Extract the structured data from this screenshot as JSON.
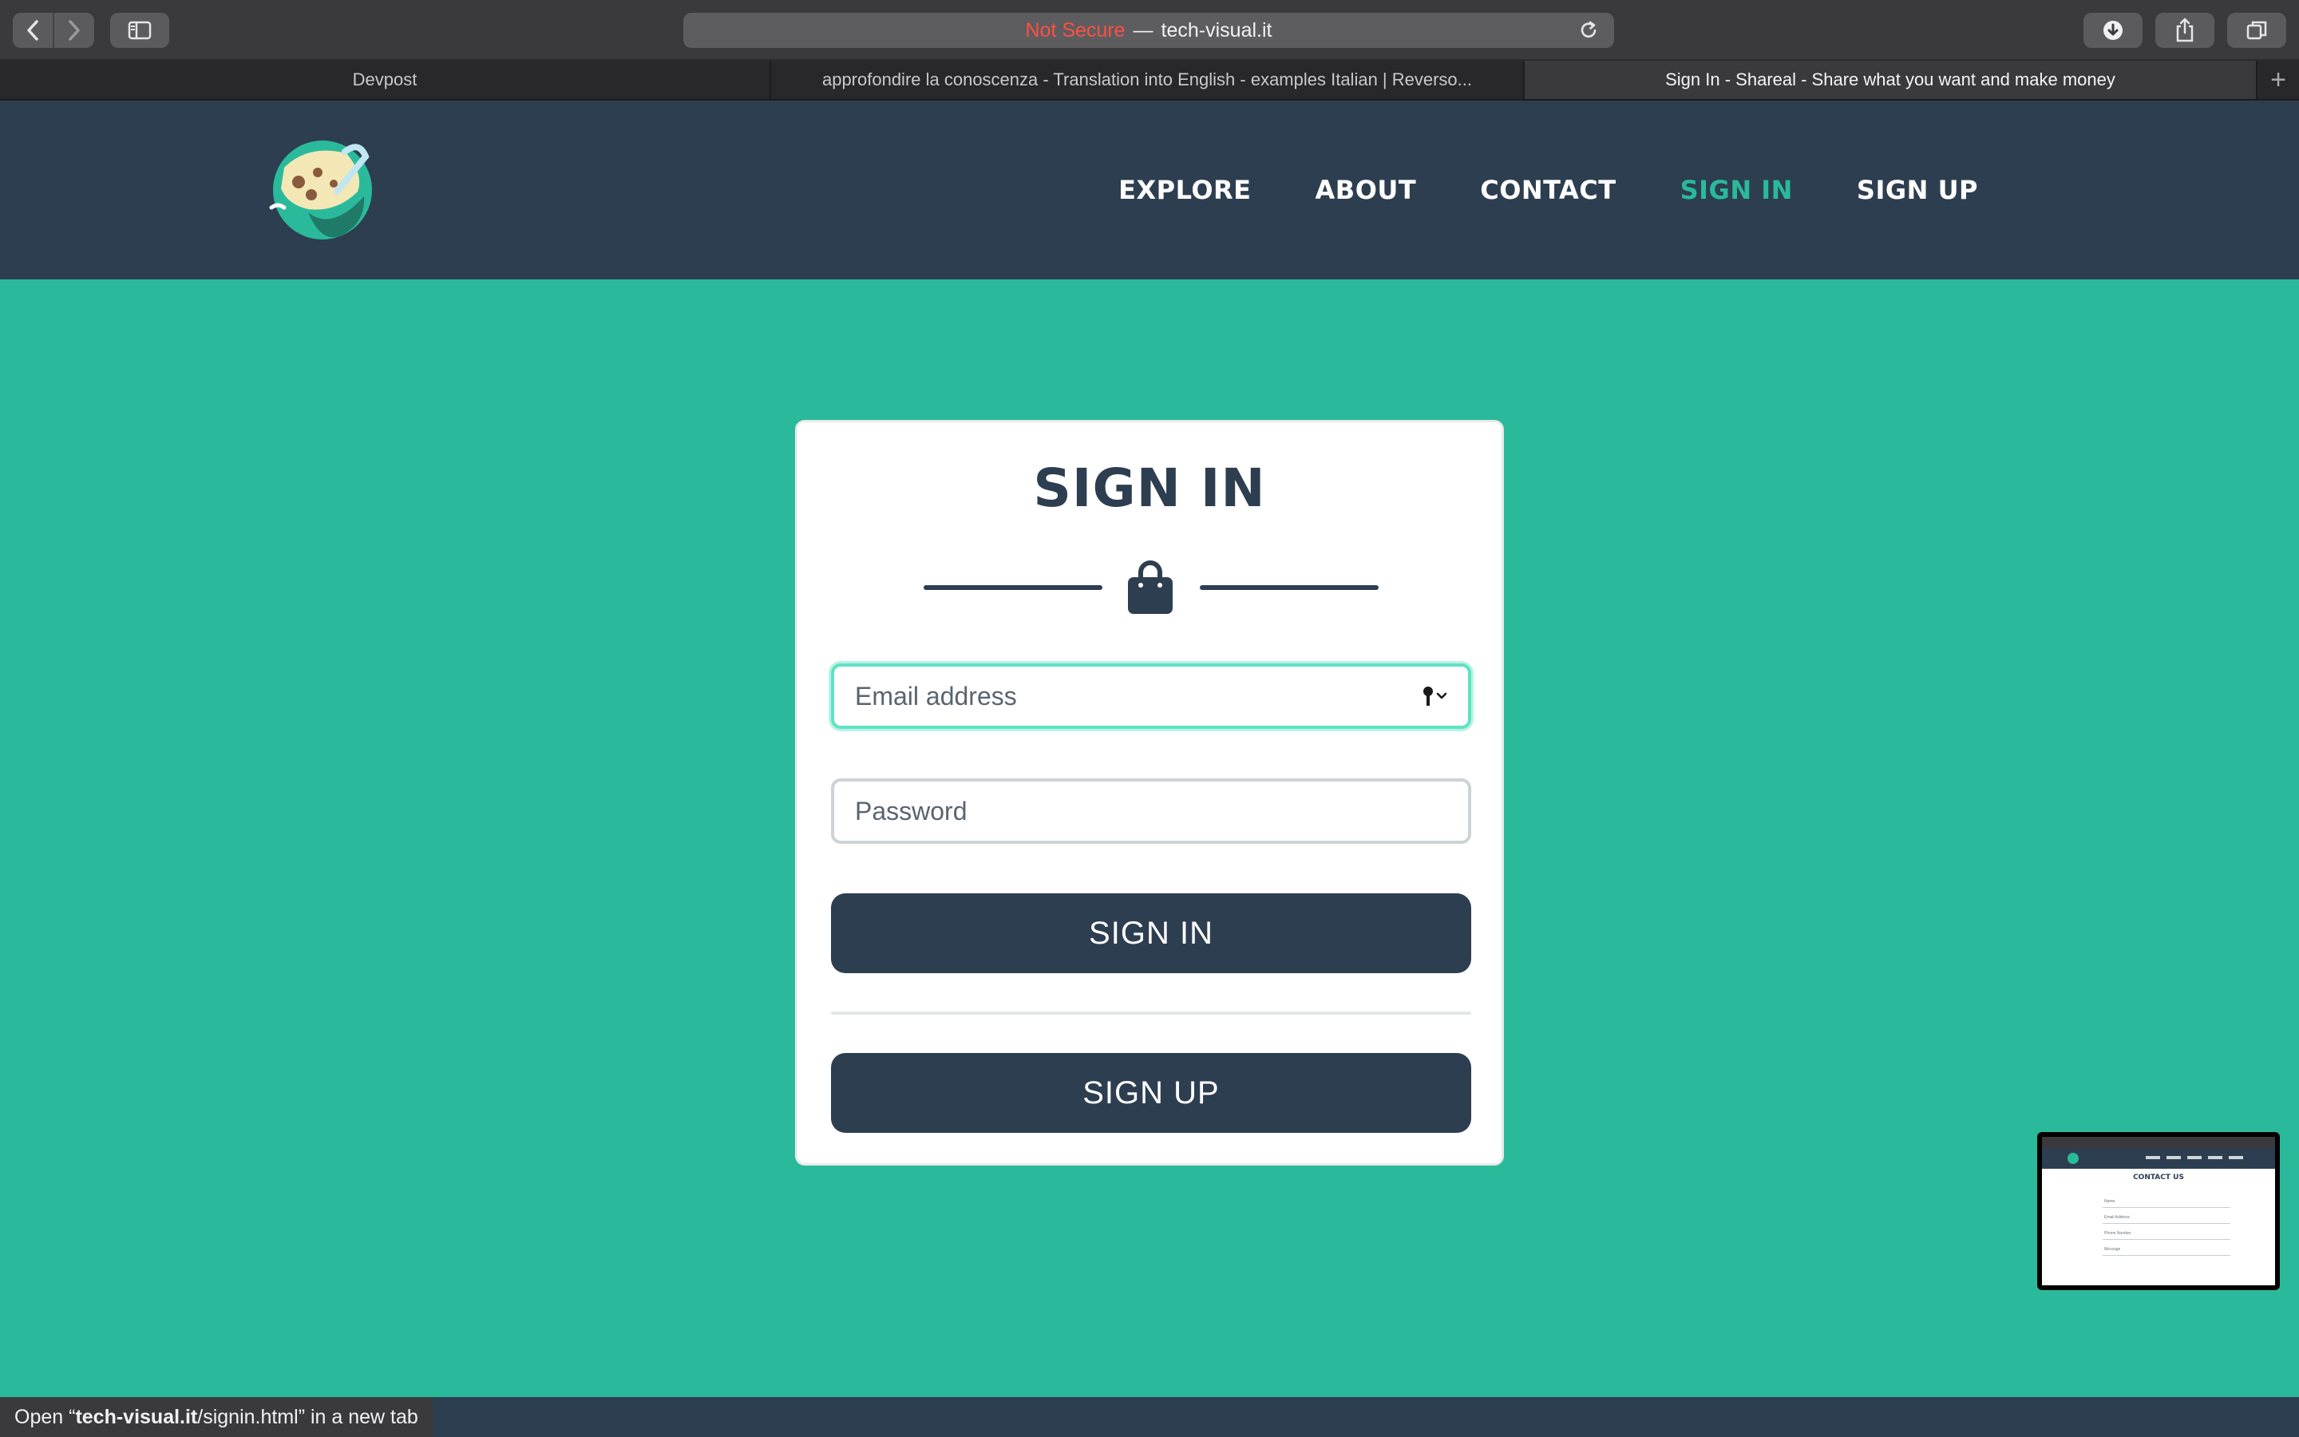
{
  "browser": {
    "url_insecure": "Not Secure",
    "url_separator": "—",
    "url_domain": "tech-visual.it",
    "tabs": [
      {
        "title": "Devpost",
        "active": false
      },
      {
        "title": "approfondire la conoscenza - Translation into English - examples Italian | Reverso...",
        "active": false
      },
      {
        "title": "Sign In - Shareal - Share what you want and make money",
        "active": true
      }
    ],
    "status_prefix": "Open “",
    "status_domain": "tech-visual.it",
    "status_path": "/signin.html",
    "status_suffix": "” in a new tab"
  },
  "site": {
    "nav": [
      {
        "label": "EXPLORE",
        "active": false
      },
      {
        "label": "ABOUT",
        "active": false
      },
      {
        "label": "CONTACT",
        "active": false
      },
      {
        "label": "SIGN IN",
        "active": true
      },
      {
        "label": "SIGN UP",
        "active": false
      }
    ]
  },
  "signin": {
    "title": "SIGN IN",
    "email_placeholder": "Email address",
    "password_placeholder": "Password",
    "signin_button": "SIGN IN",
    "signup_button": "SIGN UP"
  },
  "preview": {
    "title": "CONTACT US",
    "labels": [
      "Name",
      "Email Address",
      "Phone Number",
      "Message"
    ]
  },
  "colors": {
    "accent": "#2aba9b",
    "navy": "#2d3e50",
    "focus_border": "#5fe2c5"
  }
}
